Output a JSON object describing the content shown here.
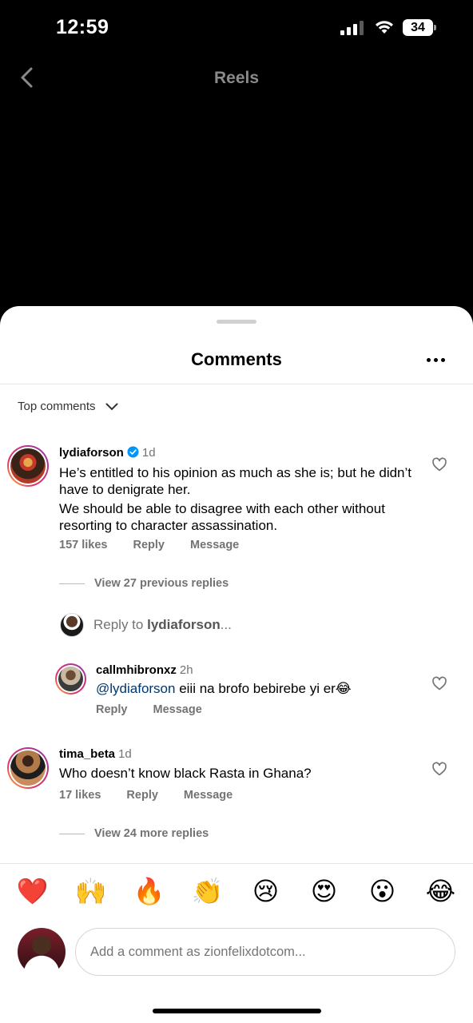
{
  "status_bar": {
    "time": "12:59",
    "battery": "34"
  },
  "header": {
    "title": "Reels"
  },
  "sheet": {
    "title": "Comments",
    "sort_label": "Top comments"
  },
  "comments": [
    {
      "username": "lydiaforson",
      "verified": true,
      "time": "1d",
      "text_1": "He’s entitled to his opinion as much as she is;  but he didn’t have to denigrate her.",
      "text_2": "We should be able to disagree with each other without resorting to character assassination.",
      "likes": "157 likes",
      "reply": "Reply",
      "message": "Message",
      "view_replies": "View 27 previous replies"
    },
    {
      "username": "tima_beta",
      "time": "1d",
      "text": "Who doesn’t know black Rasta in Ghana?",
      "likes": "17 likes",
      "reply": "Reply",
      "message": "Message",
      "view_replies": "View 24 more replies"
    }
  ],
  "reply_box": {
    "prefix": "Reply to ",
    "target": "lydiaforson",
    "suffix": "..."
  },
  "reply": {
    "username": "callmhibronxz",
    "time": "2h",
    "mention": "@lydiaforson",
    "text": " eiii na brofo bebirebe yi er😂",
    "reply": "Reply",
    "message": "Message"
  },
  "emoji_bar": [
    "❤️",
    "🙌",
    "🔥",
    "👏",
    "😢",
    "😍",
    "😮",
    "😂"
  ],
  "composer": {
    "placeholder": "Add a comment as zionfelixdotcom..."
  },
  "colors": {
    "sheet_bg": "#ffffff",
    "muted": "#737373",
    "mention": "#00376b",
    "verified": "#0095f6"
  }
}
